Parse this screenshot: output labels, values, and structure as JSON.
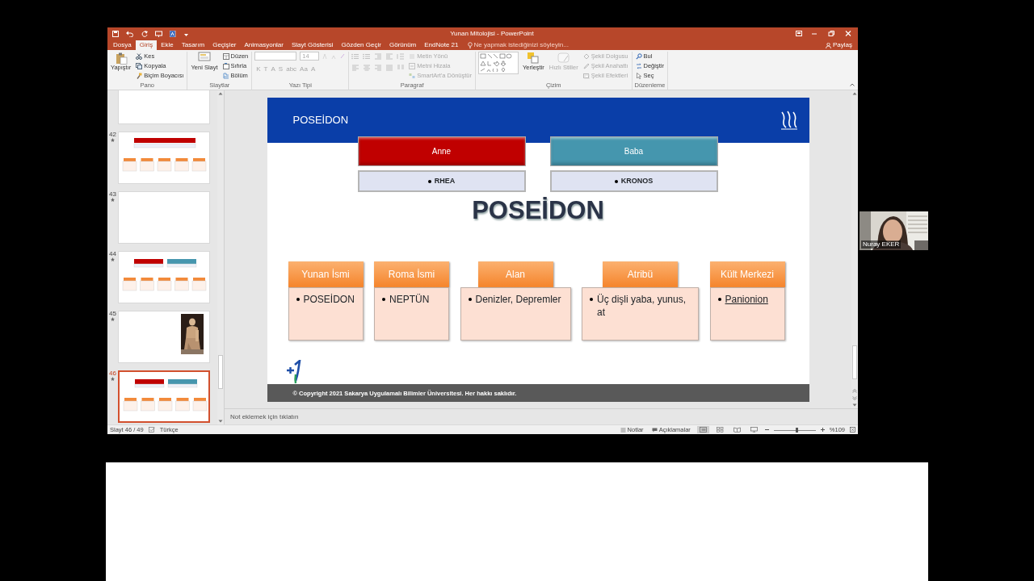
{
  "window": {
    "title": "Yunan Mitolojisi - PowerPoint"
  },
  "ribbon_tabs": [
    {
      "label": "Dosya",
      "selected": false
    },
    {
      "label": "Giriş",
      "selected": true
    },
    {
      "label": "Ekle",
      "selected": false
    },
    {
      "label": "Tasarım",
      "selected": false
    },
    {
      "label": "Geçişler",
      "selected": false
    },
    {
      "label": "Animasyonlar",
      "selected": false
    },
    {
      "label": "Slayt Gösterisi",
      "selected": false
    },
    {
      "label": "Gözden Geçir",
      "selected": false
    },
    {
      "label": "Görünüm",
      "selected": false
    },
    {
      "label": "EndNote 21",
      "selected": false
    }
  ],
  "tell_me": {
    "placeholder": "Ne yapmak istediğinizi söyleyin..."
  },
  "share": {
    "label": "Paylaş"
  },
  "ribbon_groups": [
    {
      "name": "Pano",
      "kind": "basic",
      "commands": [
        {
          "label": "Yapıştır",
          "kind": "large",
          "disabled": false
        },
        {
          "label": "Kes",
          "kind": "small",
          "disabled": false
        },
        {
          "label": "Kopyala",
          "kind": "small",
          "disabled": false
        },
        {
          "label": "Biçim Boyacısı",
          "kind": "small",
          "disabled": false
        }
      ]
    },
    {
      "name": "Slaytlar",
      "kind": "basic",
      "commands": [
        {
          "label": "Yeni Slayt",
          "kind": "large",
          "disabled": false
        },
        {
          "label": "Düzen",
          "kind": "small",
          "disabled": false
        },
        {
          "label": "Sıfırla",
          "kind": "small",
          "disabled": false
        },
        {
          "label": "Bölüm",
          "kind": "small",
          "disabled": false
        }
      ]
    },
    {
      "name": "Yazı Tipi",
      "kind": "font",
      "disabled": true,
      "font_size": "14",
      "format_buttons": [
        "K",
        "T",
        "A",
        "S",
        "abc",
        "Aa",
        "A"
      ]
    },
    {
      "name": "Paragraf",
      "kind": "paragraph",
      "commands": [
        {
          "label": "Metin Yönü",
          "kind": "small",
          "disabled": true
        },
        {
          "label": "Metni Hizala",
          "kind": "small",
          "disabled": true
        },
        {
          "label": "SmartArt'a Dönüştür",
          "kind": "small",
          "disabled": true
        }
      ]
    },
    {
      "name": "Çizim",
      "kind": "drawing",
      "commands": [
        {
          "label": "Yerleştir",
          "kind": "large",
          "disabled": false
        },
        {
          "label": "Hızlı Stiller",
          "kind": "large",
          "disabled": true
        },
        {
          "label": "Şekil Dolgusu",
          "kind": "small",
          "disabled": true
        },
        {
          "label": "Şekil Anahattı",
          "kind": "small",
          "disabled": true
        },
        {
          "label": "Şekil Efektleri",
          "kind": "small",
          "disabled": true
        }
      ]
    },
    {
      "name": "Düzenleme",
      "kind": "basic",
      "commands": [
        {
          "label": "Bul",
          "kind": "small",
          "disabled": false
        },
        {
          "label": "Değiştir",
          "kind": "small",
          "disabled": false
        },
        {
          "label": "Seç",
          "kind": "small",
          "disabled": false
        }
      ]
    }
  ],
  "thumbnails": [
    {
      "kind": "blank",
      "selected": false
    },
    {
      "number": "42",
      "kind": "one_parent",
      "selected": false
    },
    {
      "number": "43",
      "kind": "blank",
      "selected": false
    },
    {
      "number": "44",
      "kind": "two_parents",
      "selected": false
    },
    {
      "number": "45",
      "kind": "picture",
      "selected": false
    },
    {
      "number": "46",
      "kind": "two_parents",
      "selected": true
    }
  ],
  "slide": {
    "title": "POSEİDON",
    "parents": [
      {
        "label": "Anne",
        "value": "RHEA",
        "color": "#c00000"
      },
      {
        "label": "Baba",
        "value": "KRONOS",
        "color": "#4596ae"
      }
    ],
    "heading": "POSEİDON",
    "attributes": [
      {
        "label": "Yunan İsmi",
        "value": "POSEİDON",
        "link": false
      },
      {
        "label": "Roma İsmi",
        "value": "NEPTÜN",
        "link": false
      },
      {
        "label": "Alan",
        "value": "Denizler, Depremler",
        "link": false
      },
      {
        "label": "Atribü",
        "value": "Üç dişli yaba, yunus, at",
        "link": false
      },
      {
        "label": "Kült Merkezi",
        "value": "Panionion",
        "link": true
      }
    ],
    "footer": "© Copyright 2021 Sakarya Uygulamalı Bilimler Üniversitesi. Her hakkı saklıdır."
  },
  "notes": {
    "placeholder": "Not eklemek için tıklatın"
  },
  "status_bar": {
    "slide_counter": "Slayt 46 / 49",
    "language": "Türkçe",
    "notes_button": "Notlar",
    "comments_button": "Açıklamalar",
    "views": [
      {
        "kind": "normal",
        "selected": true
      },
      {
        "kind": "sorter",
        "selected": false
      },
      {
        "kind": "reading",
        "selected": false
      },
      {
        "kind": "slideshow",
        "selected": false
      }
    ],
    "zoom": {
      "level": 0.55,
      "reading": "%109"
    }
  },
  "webcam": {
    "name": "Nuray EKER"
  }
}
